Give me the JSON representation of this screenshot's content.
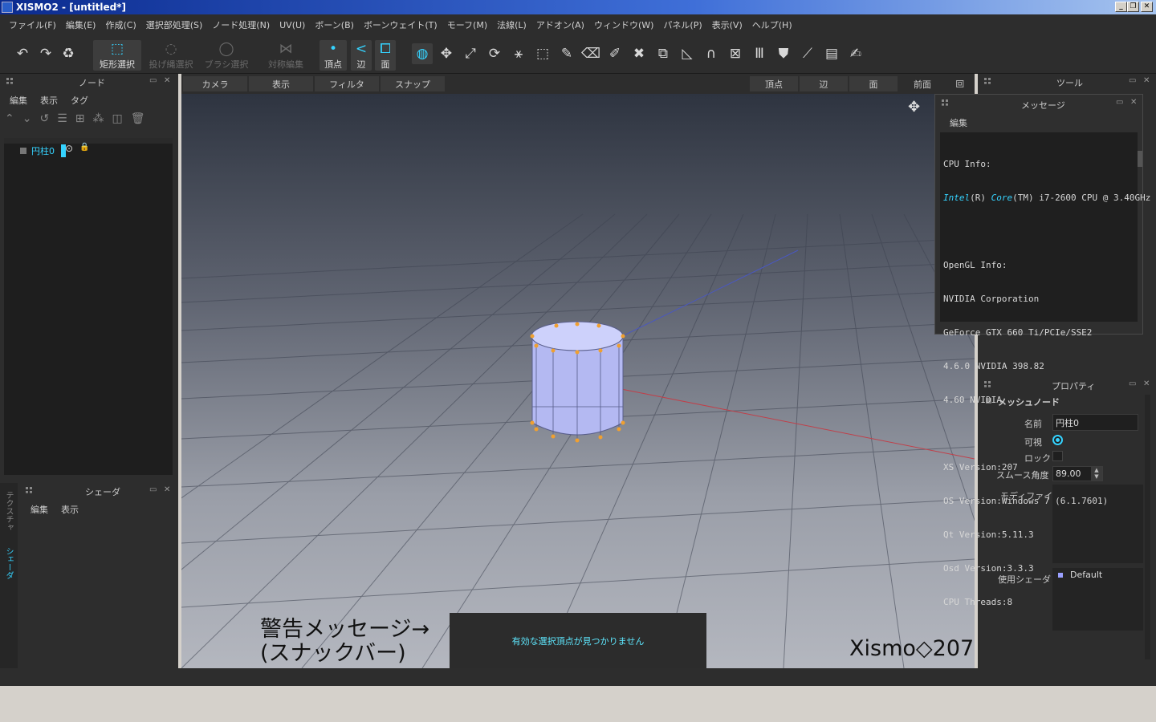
{
  "window": {
    "title": "XISMO2 - [untitled*]",
    "min": "_",
    "max": "❐",
    "close": "✕"
  },
  "menu": [
    "ファイル(F)",
    "編集(E)",
    "作成(C)",
    "選択部処理(S)",
    "ノード処理(N)",
    "UV(U)",
    "ボーン(B)",
    "ボーンウェイト(T)",
    "モーフ(M)",
    "法線(L)",
    "アドオン(A)",
    "ウィンドウ(W)",
    "パネル(P)",
    "表示(V)",
    "ヘルプ(H)"
  ],
  "toolbar": {
    "rect_select": "矩形選択",
    "lasso_select": "投げ縄選択",
    "brush_select": "ブラシ選択",
    "symmetric_edit": "対称編集",
    "vertex": "頂点",
    "edge": "辺",
    "face": "面"
  },
  "node_panel": {
    "title": "ノード",
    "menu": [
      "編集",
      "表示",
      "タグ"
    ],
    "items": [
      {
        "label": "円柱0"
      }
    ]
  },
  "shader_panel": {
    "title": "シェーダ",
    "menu": [
      "編集",
      "表示"
    ]
  },
  "side_tabs": {
    "texture": "テクスチャ",
    "shader": "シェーダ"
  },
  "viewport_toolbar": {
    "camera": "カメラ",
    "display": "表示",
    "filter": "フィルタ",
    "snap": "スナップ",
    "vertex": "頂点",
    "edge": "辺",
    "face": "面",
    "front": "前面"
  },
  "tool_panel": {
    "title": "ツール"
  },
  "message_panel": {
    "title": "メッセージ",
    "menu": "編集",
    "text_lines": [
      "CPU Info:",
      "Intel(R) Core(TM) i7-2600 CPU @ 3.40GHz",
      "",
      "OpenGL Info:",
      "NVIDIA Corporation",
      "GeForce GTX 660 Ti/PCIe/SSE2",
      "4.6.0 NVIDIA 398.82",
      "4.60 NVIDIA",
      "",
      "XS Version:207",
      "OS Version:Windows 7 (6.1.7601)",
      "Qt Version:5.11.3",
      "Osd Version:3.3.3",
      "CPU Threads:8"
    ]
  },
  "property_panel": {
    "title": "プロパティ",
    "section": "メッシュノード",
    "name_label": "名前",
    "name_value": "円柱0",
    "visible_label": "可視",
    "lock_label": "ロック",
    "smooth_label": "スムース角度",
    "smooth_value": "89.00",
    "modifier_label": "モディファイア",
    "shader_label": "使用シェーダ",
    "shader_value": "Default"
  },
  "snackbar": {
    "message": "有効な選択頂点が見つかりません"
  },
  "annotation": {
    "line1": "警告メッセージ→",
    "line2": "(スナックバー)",
    "version": "Xismo◇207"
  },
  "colors": {
    "accent": "#35d3ff",
    "panel": "#2d2d2d",
    "selection": "#f0a030"
  }
}
